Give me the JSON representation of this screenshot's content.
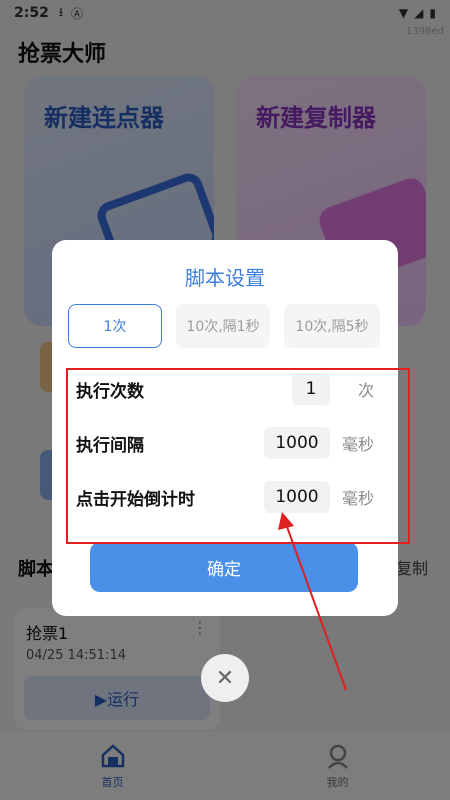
{
  "status_bar": {
    "time": "2:52",
    "icons": [
      "download-icon",
      "a-icon"
    ],
    "right_icons": [
      "wifi-icon",
      "signal-icon",
      "battery-icon"
    ],
    "watermark": "1398ed"
  },
  "app": {
    "title": "抢票大师",
    "cards": [
      {
        "title": "新建连点器"
      },
      {
        "title": "新建复制器"
      }
    ],
    "section_label": "脚本",
    "copy_label": "复制",
    "script_card": {
      "title": "抢票1",
      "date": "04/25 14:51:14",
      "run_label": "▶运行"
    },
    "tabs": [
      {
        "label": "首页",
        "icon": "home-icon",
        "active": true
      },
      {
        "label": "我的",
        "icon": "profile-icon",
        "active": false
      }
    ]
  },
  "dialog": {
    "title": "脚本设置",
    "presets": [
      "1次",
      "10次,隔1秒",
      "10次,隔5秒"
    ],
    "selected_preset": "1次",
    "rows": [
      {
        "label": "执行次数",
        "value": "1",
        "unit": "次"
      },
      {
        "label": "执行间隔",
        "value": "1000",
        "unit": "毫秒"
      },
      {
        "label": "点击开始倒计时",
        "value": "1000",
        "unit": "毫秒"
      }
    ],
    "confirm_label": "确定",
    "close_glyph": "✕"
  },
  "colors": {
    "accent": "#3d7fdc",
    "confirm": "#4a90e8",
    "annotation": "#e02020"
  }
}
